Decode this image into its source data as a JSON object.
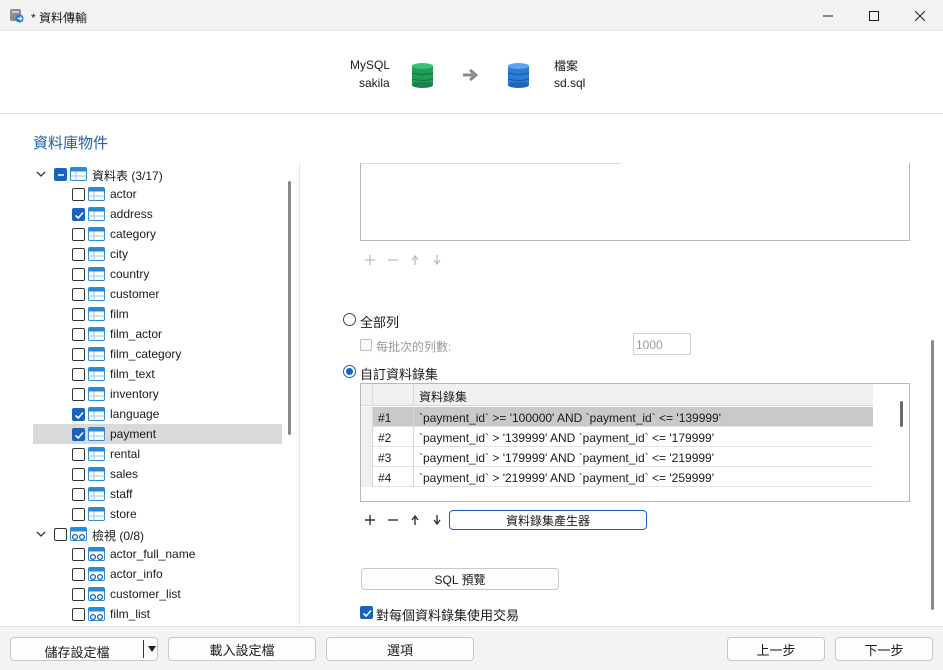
{
  "window": {
    "title": "* 資料傳輸"
  },
  "header": {
    "source_type": "MySQL",
    "source_name": "sakila",
    "target_type": "檔案",
    "target_name": "sd.sql"
  },
  "section_title": "資料庫物件",
  "tree": {
    "tables_label": "資料表",
    "tables_count": "(3/17)",
    "tables": [
      {
        "name": "actor",
        "checked": false
      },
      {
        "name": "address",
        "checked": true
      },
      {
        "name": "category",
        "checked": false
      },
      {
        "name": "city",
        "checked": false
      },
      {
        "name": "country",
        "checked": false
      },
      {
        "name": "customer",
        "checked": false
      },
      {
        "name": "film",
        "checked": false
      },
      {
        "name": "film_actor",
        "checked": false
      },
      {
        "name": "film_category",
        "checked": false
      },
      {
        "name": "film_text",
        "checked": false
      },
      {
        "name": "inventory",
        "checked": false
      },
      {
        "name": "language",
        "checked": true
      },
      {
        "name": "payment",
        "checked": true,
        "selected": true
      },
      {
        "name": "rental",
        "checked": false
      },
      {
        "name": "sales",
        "checked": false
      },
      {
        "name": "staff",
        "checked": false
      },
      {
        "name": "store",
        "checked": false
      }
    ],
    "views_label": "檢視",
    "views_count": "(0/8)",
    "views": [
      {
        "name": "actor_full_name",
        "checked": false
      },
      {
        "name": "actor_info",
        "checked": false
      },
      {
        "name": "customer_list",
        "checked": false
      },
      {
        "name": "film_list",
        "checked": false
      }
    ]
  },
  "options": {
    "all_rows_label": "全部列",
    "rows_per_batch_label": "每批次的列數:",
    "rows_per_batch_value": "1000",
    "custom_recordset_label": "自訂資料錄集",
    "recordset_column_header": "資料錄集",
    "recordsets": [
      {
        "id": "#1",
        "condition": "`payment_id` >= '100000' AND `payment_id` <= '139999'"
      },
      {
        "id": "#2",
        "condition": "`payment_id` > '139999' AND `payment_id` <= '179999'"
      },
      {
        "id": "#3",
        "condition": "`payment_id` > '179999' AND `payment_id` <= '219999'"
      },
      {
        "id": "#4",
        "condition": "`payment_id` > '219999' AND `payment_id` <= '259999'"
      }
    ],
    "recordset_generator_label": "資料錄集產生器",
    "sql_preview_label": "SQL 預覽",
    "use_transaction_label": "對每個資料錄集使用交易"
  },
  "footer": {
    "save_profile": "儲存設定檔",
    "load_profile": "載入設定檔",
    "options": "選項",
    "back": "上一步",
    "next": "下一步"
  },
  "colors": {
    "accent": "#1764c0",
    "mysql_db": "#1f9d55",
    "file_db": "#2b7bd8"
  }
}
